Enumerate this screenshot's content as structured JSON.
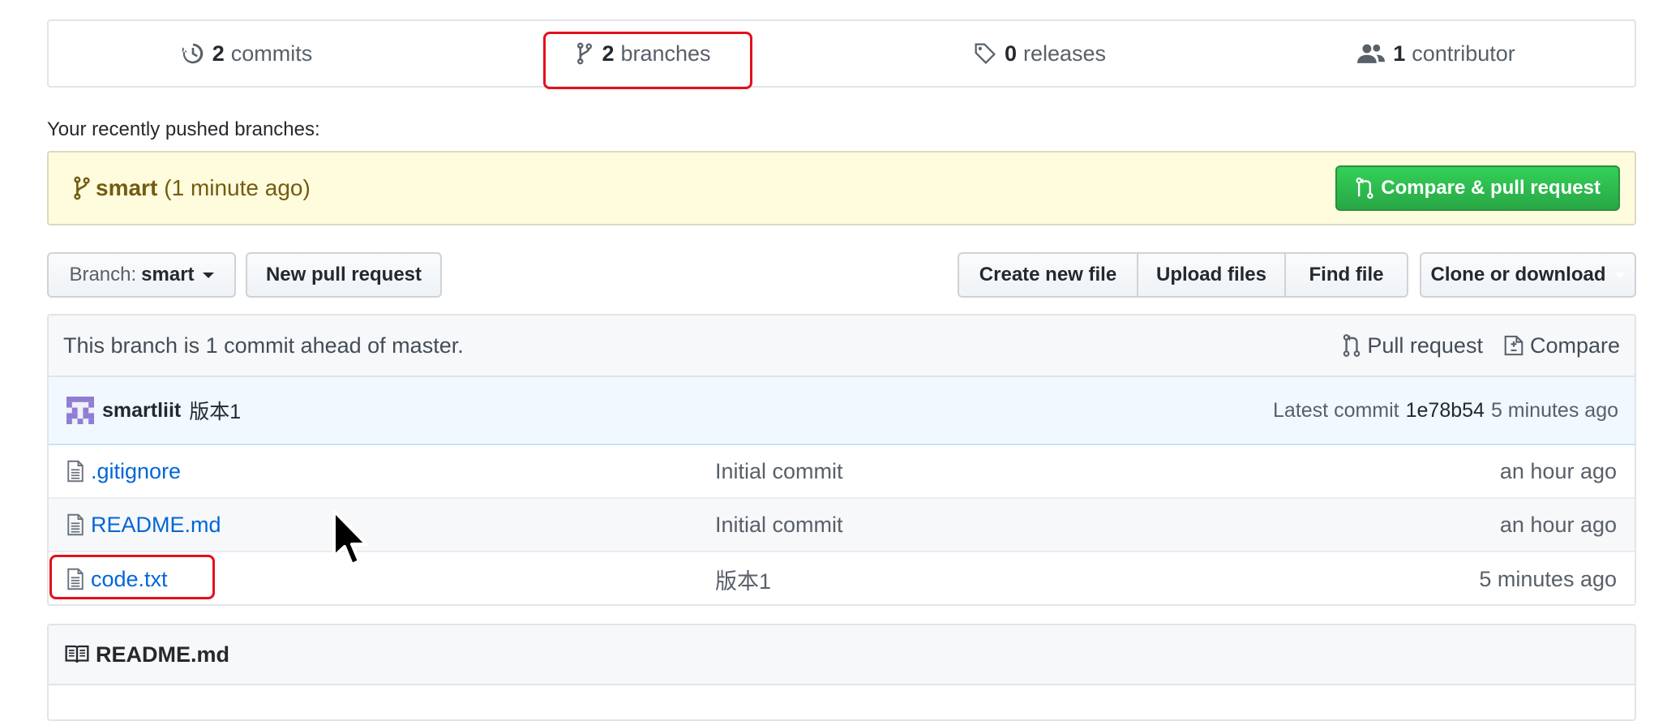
{
  "summary": {
    "commits": {
      "count": "2",
      "label": "commits",
      "icon": "history-icon"
    },
    "branches": {
      "count": "2",
      "label": "branches",
      "icon": "git-branch-icon"
    },
    "releases": {
      "count": "0",
      "label": "releases",
      "icon": "tag-icon"
    },
    "contributors": {
      "count": "1",
      "label": "contributor",
      "icon": "people-icon"
    }
  },
  "recent": {
    "label": "Your recently pushed branches:",
    "branch": "smart",
    "time": "(1 minute ago)",
    "compare_button": "Compare & pull request"
  },
  "toolbar": {
    "branch_prefix": "Branch:",
    "branch_name": "smart",
    "new_pr": "New pull request",
    "create_file": "Create new file",
    "upload_files": "Upload files",
    "find_file": "Find file",
    "clone": "Clone or download"
  },
  "tease": {
    "text": "This branch is 1 commit ahead of master.",
    "pull_request": "Pull request",
    "compare": "Compare"
  },
  "latest_commit": {
    "author": "smartliit",
    "message": "版本1",
    "prefix": "Latest commit",
    "sha": "1e78b54",
    "age": "5 minutes ago"
  },
  "files": [
    {
      "name": ".gitignore",
      "message": "Initial commit",
      "age": "an hour ago"
    },
    {
      "name": "README.md",
      "message": "Initial commit",
      "age": "an hour ago"
    },
    {
      "name": "code.txt",
      "message": "版本1",
      "age": "5 minutes ago"
    }
  ],
  "readme": {
    "title": "README.md"
  },
  "colors": {
    "accent_green": "#28a745",
    "link": "#0366d6",
    "highlight_box": "#e3101b",
    "recent_bar_bg": "#fffbdd",
    "commit_row_bg": "#f1f8ff"
  }
}
